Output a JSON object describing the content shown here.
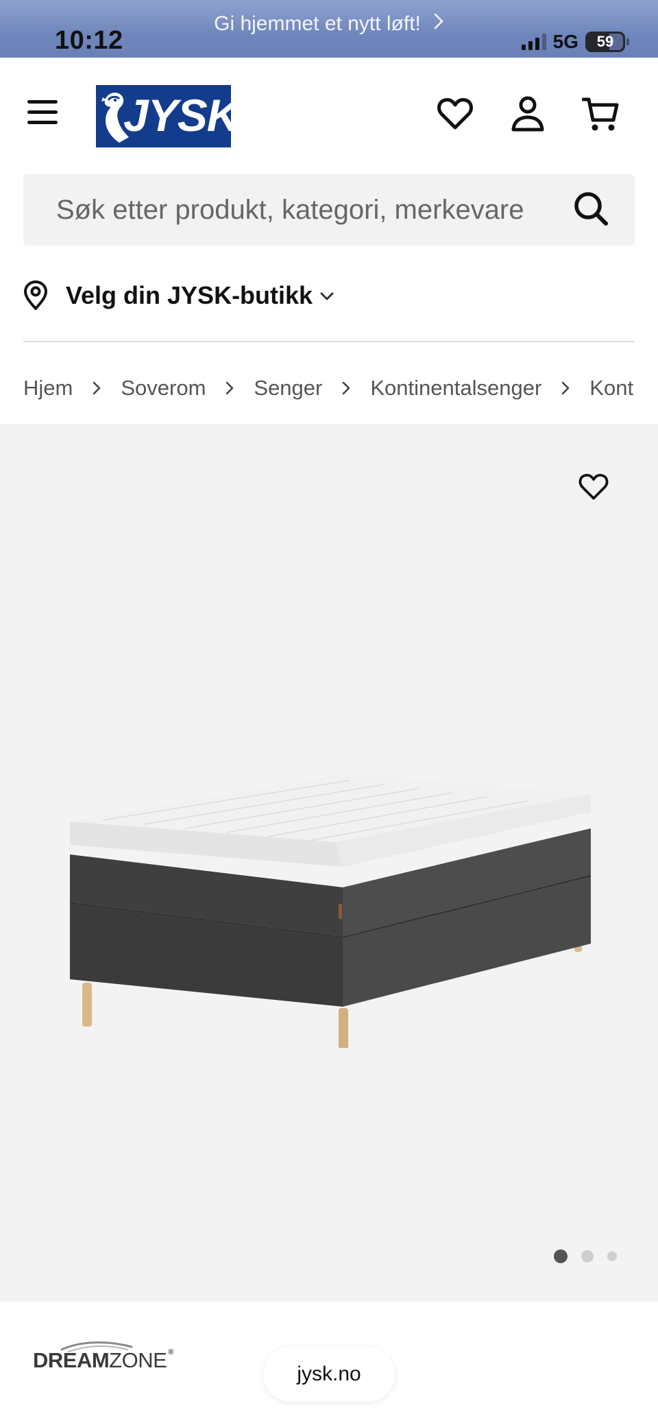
{
  "status_bar": {
    "time": "10:12",
    "network": "5G",
    "battery": "59",
    "signal_bars_active": 3,
    "signal_bars_total": 4
  },
  "promo": {
    "text": "Gi hjemmet et nytt løft!"
  },
  "header": {
    "logo_text": "JYSK",
    "icons": [
      "menu-icon",
      "heart-icon",
      "user-icon",
      "cart-icon"
    ],
    "brand_color": "#143c8c"
  },
  "search": {
    "placeholder": "Søk etter produkt, kategori, merkevare"
  },
  "store": {
    "label": "Velg din JYSK-butikk"
  },
  "breadcrumbs": [
    {
      "label": "Hjem"
    },
    {
      "label": "Soverom"
    },
    {
      "label": "Senger"
    },
    {
      "label": "Kontinentalsenger"
    },
    {
      "label": "Kontinentalseng"
    }
  ],
  "gallery": {
    "current_index": 1,
    "total": 3
  },
  "footer": {
    "brand_bold": "DREAM",
    "brand_thin": "ZONE",
    "brand_mark": "®",
    "url": "jysk.no"
  }
}
